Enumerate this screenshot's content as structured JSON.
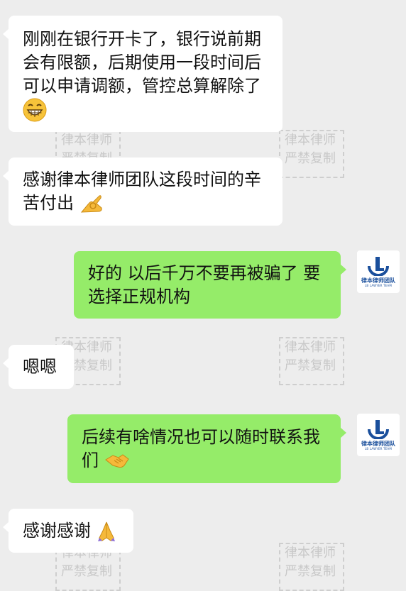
{
  "messages": [
    {
      "side": "left",
      "lines": [
        "刚刚在银行开卡了，银行说前期",
        "会有限额，后期使用一段时间后",
        "可以申请调额，管控总算解除了"
      ],
      "emoji": "grinning-face-emoji"
    },
    {
      "side": "left",
      "lines": [
        "感谢律本律师团队这段时间的辛",
        "苦付出"
      ],
      "emoji": "ok-hand-emoji"
    },
    {
      "side": "right",
      "lines": [
        "好的 以后千万不要再被骗了 要",
        "选择正规机构"
      ]
    },
    {
      "side": "left",
      "lines": [
        "嗯嗯"
      ]
    },
    {
      "side": "right",
      "lines": [
        "后续有啥情况也可以随时联系我",
        "们"
      ],
      "emoji": "handshake-emoji"
    },
    {
      "side": "left",
      "lines": [
        "感谢感谢"
      ],
      "emoji": "folded-hands-emoji"
    }
  ],
  "avatar": {
    "name": "律本律师团队",
    "subtitle": "LB LAWYER TEAM",
    "logo_color": "#1a4f9c",
    "icon": "law-firm-logo-icon"
  },
  "watermark": {
    "line1": "律本律师",
    "line2": "严禁复制"
  },
  "colors": {
    "background": "#ededed",
    "left_bubble": "#ffffff",
    "right_bubble": "#95ec69",
    "text": "#111111"
  }
}
